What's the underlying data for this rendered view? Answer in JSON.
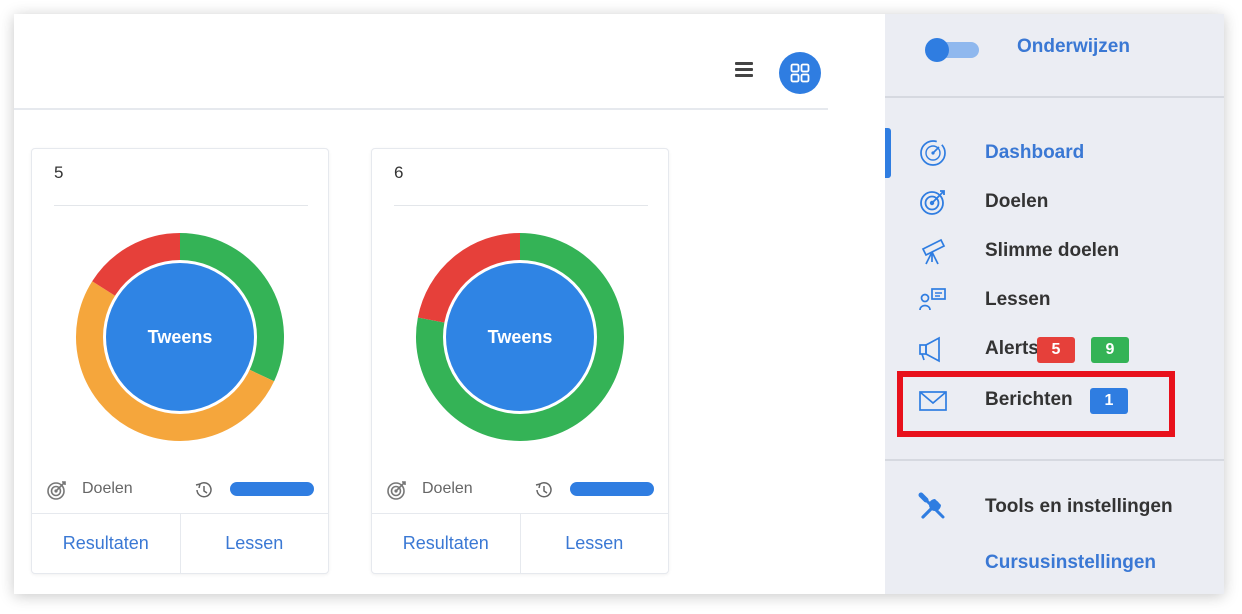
{
  "view_controls": {
    "list_icon": "list-lines-icon",
    "grid_icon": "grid-icon"
  },
  "cards": [
    {
      "number": "5",
      "center_label": "Tweens",
      "ring_segments": [
        {
          "color": "#34b356",
          "share": 0.32
        },
        {
          "color": "#f5a63c",
          "share": 0.52
        },
        {
          "color": "#e6403a",
          "share": 0.16
        }
      ],
      "stat_label": "Doelen",
      "links": {
        "results": "Resultaten",
        "lessons": "Lessen"
      }
    },
    {
      "number": "6",
      "center_label": "Tweens",
      "ring_segments": [
        {
          "color": "#34b356",
          "share": 0.78
        },
        {
          "color": "#e6403a",
          "share": 0.22
        }
      ],
      "stat_label": "Doelen",
      "links": {
        "results": "Resultaten",
        "lessons": "Lessen"
      }
    }
  ],
  "sidebar": {
    "mode_label": "Onderwijzen",
    "items": [
      {
        "label": "Dashboard",
        "icon": "speedometer-icon"
      },
      {
        "label": "Doelen",
        "icon": "target-icon"
      },
      {
        "label": "Slimme doelen",
        "icon": "telescope-icon"
      },
      {
        "label": "Lessen",
        "icon": "teacher-board-icon"
      },
      {
        "label": "Alerts",
        "icon": "megaphone-icon",
        "badges": [
          "5",
          "9"
        ]
      },
      {
        "label": "Berichten",
        "icon": "envelope-icon",
        "badges": [
          "1"
        ]
      },
      {
        "label": "Tools en instellingen",
        "icon": "tools-icon"
      }
    ],
    "sub_link": "Cursusinstellingen"
  },
  "colors": {
    "accent": "#2f7de1",
    "highlight": "#e8111b",
    "alert_red": "#e6403a",
    "alert_green": "#34b356",
    "ring_orange": "#f5a63c"
  }
}
